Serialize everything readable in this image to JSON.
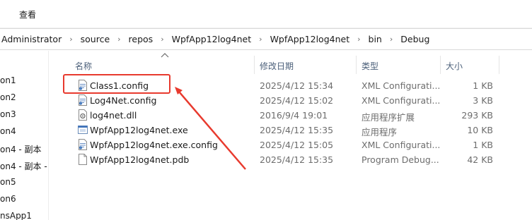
{
  "ribbon": {
    "view_label": "查看"
  },
  "breadcrumb": [
    "Administrator",
    "source",
    "repos",
    "WpfApp12log4net",
    "WpfApp12log4net",
    "bin",
    "Debug"
  ],
  "nav": [
    "on1",
    "on2",
    "on3",
    "on4",
    "on4 - 副本",
    "on4 - 副本 -",
    "on5",
    "on6",
    "nsApp1"
  ],
  "columns": {
    "name": "名称",
    "modified": "修改日期",
    "type": "类型",
    "size": "大小"
  },
  "files": [
    {
      "name": "Class1.config",
      "modified": "2025/4/12 15:34",
      "type": "XML Configurati...",
      "size": "1 KB",
      "icon": "config-file-icon"
    },
    {
      "name": "Log4Net.config",
      "modified": "2025/4/12 15:02",
      "type": "XML Configurati...",
      "size": "3 KB",
      "icon": "config-file-icon"
    },
    {
      "name": "log4net.dll",
      "modified": "2016/9/4 19:01",
      "type": "应用程序扩展",
      "size": "293 KB",
      "icon": "dll-file-icon"
    },
    {
      "name": "WpfApp12log4net.exe",
      "modified": "2025/4/12 15:35",
      "type": "应用程序",
      "size": "10 KB",
      "icon": "exe-file-icon"
    },
    {
      "name": "WpfApp12log4net.exe.config",
      "modified": "2025/4/12 15:05",
      "type": "XML Configurati...",
      "size": "1 KB",
      "icon": "config-file-icon"
    },
    {
      "name": "WpfApp12log4net.pdb",
      "modified": "2025/4/12 15:35",
      "type": "Program Debug...",
      "size": "42 KB",
      "icon": "blank-file-icon"
    }
  ],
  "annotation": {
    "color": "#e83a2e",
    "target": "Class1.config"
  }
}
